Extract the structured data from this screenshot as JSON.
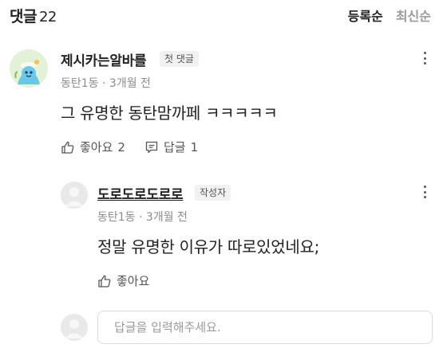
{
  "header": {
    "title": "댓글",
    "count": "22",
    "sort_options": [
      {
        "label": "등록순",
        "active": true
      },
      {
        "label": "최신순",
        "active": false
      }
    ]
  },
  "comments": [
    {
      "author": "제시카는알바를",
      "badge": "첫 댓글",
      "location": "동탄1동",
      "time": "3개월 전",
      "text": "그 유명한 동탄맘까페 ㅋㅋㅋㅋㅋ",
      "like_label": "좋아요",
      "like_count": "2",
      "reply_label": "답글",
      "reply_count": "1"
    }
  ],
  "reply": {
    "author": "도로도로도로로",
    "badge": "작성자",
    "location": "동탄1동",
    "time": "3개월 전",
    "text": "정말 유명한 이유가 따로있었네요;",
    "like_label": "좋아요"
  },
  "reply_input": {
    "placeholder": "답글을 입력해주세요."
  },
  "colors": {
    "text_primary": "#222222",
    "text_secondary": "#8c8c8c",
    "sort_inactive": "#9a9a9a",
    "badge_bg": "#f1f1f1",
    "avatar_bg": "#e3f2d7"
  }
}
